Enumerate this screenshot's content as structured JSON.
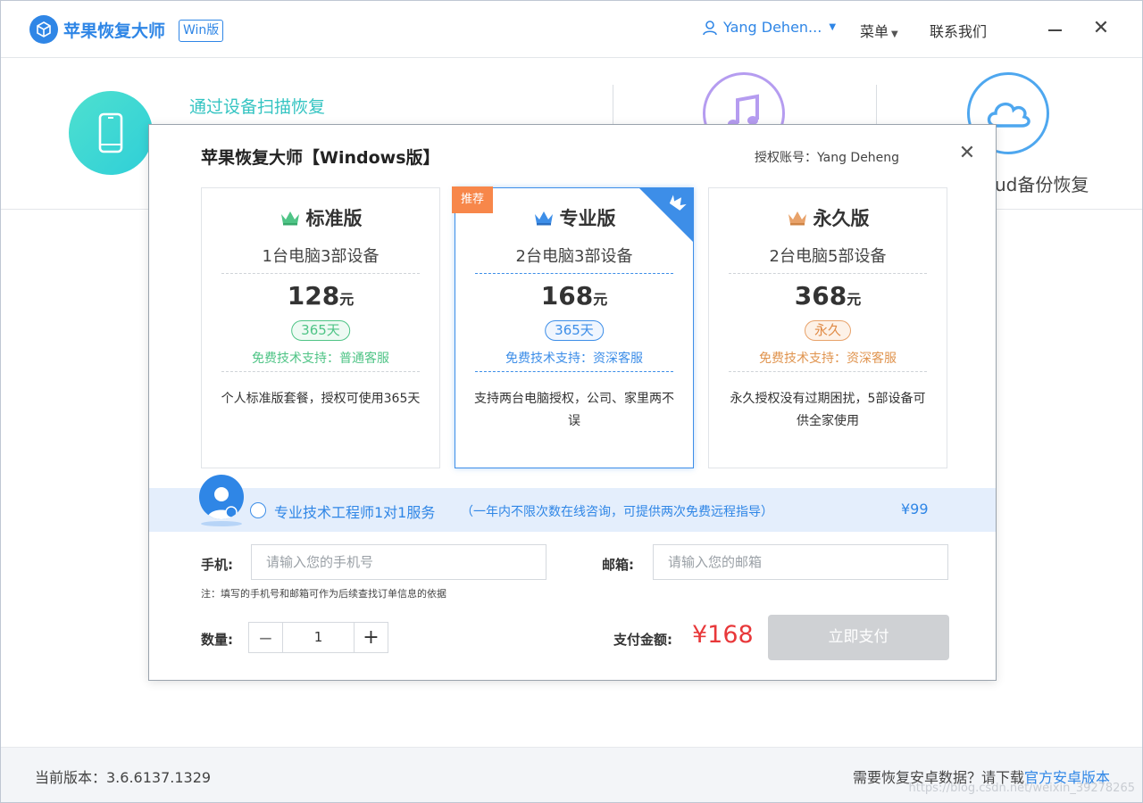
{
  "titlebar": {
    "app_title": "苹果恢复大师",
    "badge": "Win版",
    "user": "Yang Dehen...",
    "menu": "菜单",
    "contact": "联系我们"
  },
  "background": {
    "option_scan": "通过设备扫描恢复",
    "option_icloud": "ud备份恢复"
  },
  "modal": {
    "title": "苹果恢复大师【Windows版】",
    "account": "授权账号：Yang Deheng",
    "plans": [
      {
        "name": "标准版",
        "devices": "1台电脑3部设备",
        "price": "128",
        "unit": "元",
        "period": "365天",
        "support": "免费技术支持：普通客服",
        "desc": "个人标准版套餐，授权可使用365天",
        "crown_color": "#4fc486"
      },
      {
        "name": "专业版",
        "devices": "2台电脑3部设备",
        "price": "168",
        "unit": "元",
        "period": "365天",
        "support": "免费技术支持：资深客服",
        "desc": "支持两台电脑授权，公司、家里两不误",
        "tag": "推荐",
        "crown_color": "#3d8ee8"
      },
      {
        "name": "永久版",
        "devices": "2台电脑5部设备",
        "price": "368",
        "unit": "元",
        "period": "永久",
        "support": "免费技术支持：资深客服",
        "desc": "永久授权没有过期困扰，5部设备可供全家使用",
        "crown_color": "#e8a26a"
      }
    ],
    "service": {
      "title": "专业技术工程师1对1服务",
      "note": "（一年内不限次数在线咨询，可提供两次免费远程指导）",
      "price": "¥99"
    },
    "form": {
      "phone_label": "手机:",
      "phone_placeholder": "请输入您的手机号",
      "email_label": "邮箱:",
      "email_placeholder": "请输入您的邮箱",
      "hint": "注：填写的手机号和邮箱可作为后续查找订单信息的依据",
      "qty_label": "数量:",
      "qty_value": "1",
      "pay_label": "支付金额:",
      "pay_amount": "¥168",
      "pay_button": "立即支付"
    }
  },
  "footer": {
    "version": "当前版本：3.6.6137.1329",
    "android_text": "需要恢复安卓数据？请下载",
    "android_link": "官方安卓版本",
    "watermark": "https://blog.csdn.net/weixin_39278265"
  },
  "colors": {
    "accent": "#2f86e6",
    "price_red": "#e8383a",
    "teal": "#34c4c2"
  }
}
